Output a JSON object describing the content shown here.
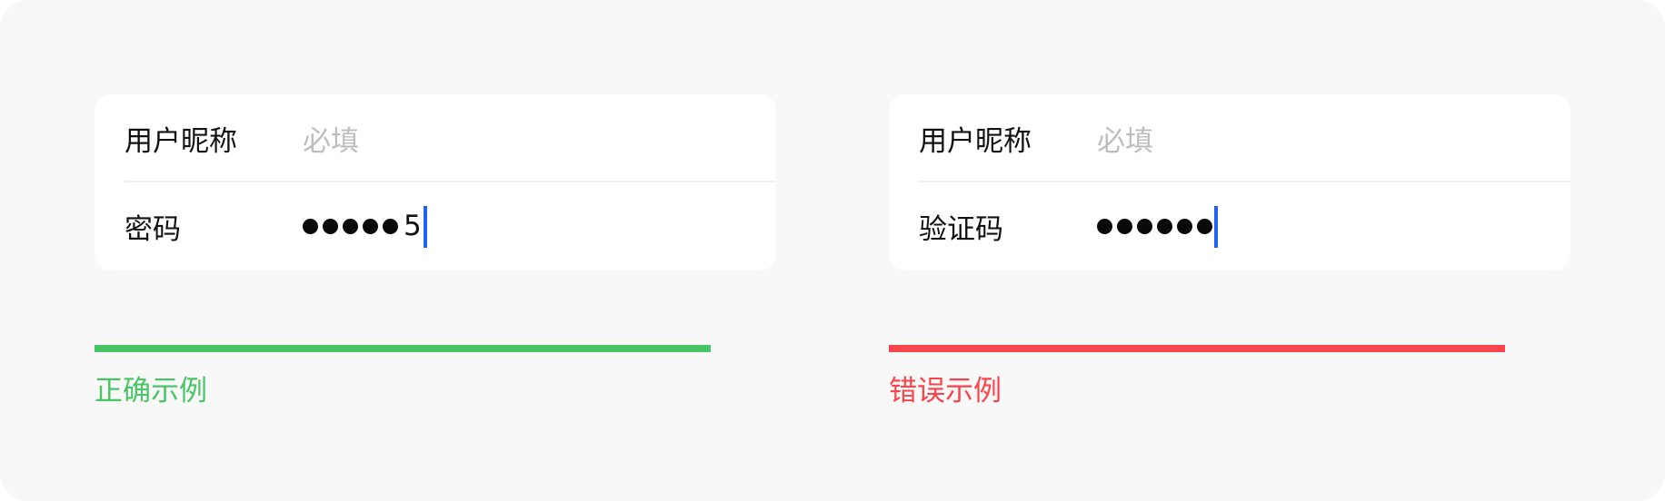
{
  "colors": {
    "background": "#f8f8f8",
    "card": "#ffffff",
    "correct": "#48c564",
    "wrong": "#fa434a",
    "caret": "#1f63f0",
    "placeholder": "#bdbdbd"
  },
  "correct_example": {
    "nickname_label": "用户昵称",
    "nickname_placeholder": "必填",
    "password_label": "密码",
    "password_masked_count": 5,
    "password_visible_char": "5",
    "caption": "正确示例"
  },
  "wrong_example": {
    "nickname_label": "用户昵称",
    "nickname_placeholder": "必填",
    "code_label": "验证码",
    "code_masked_count": 6,
    "caption": "错误示例"
  }
}
